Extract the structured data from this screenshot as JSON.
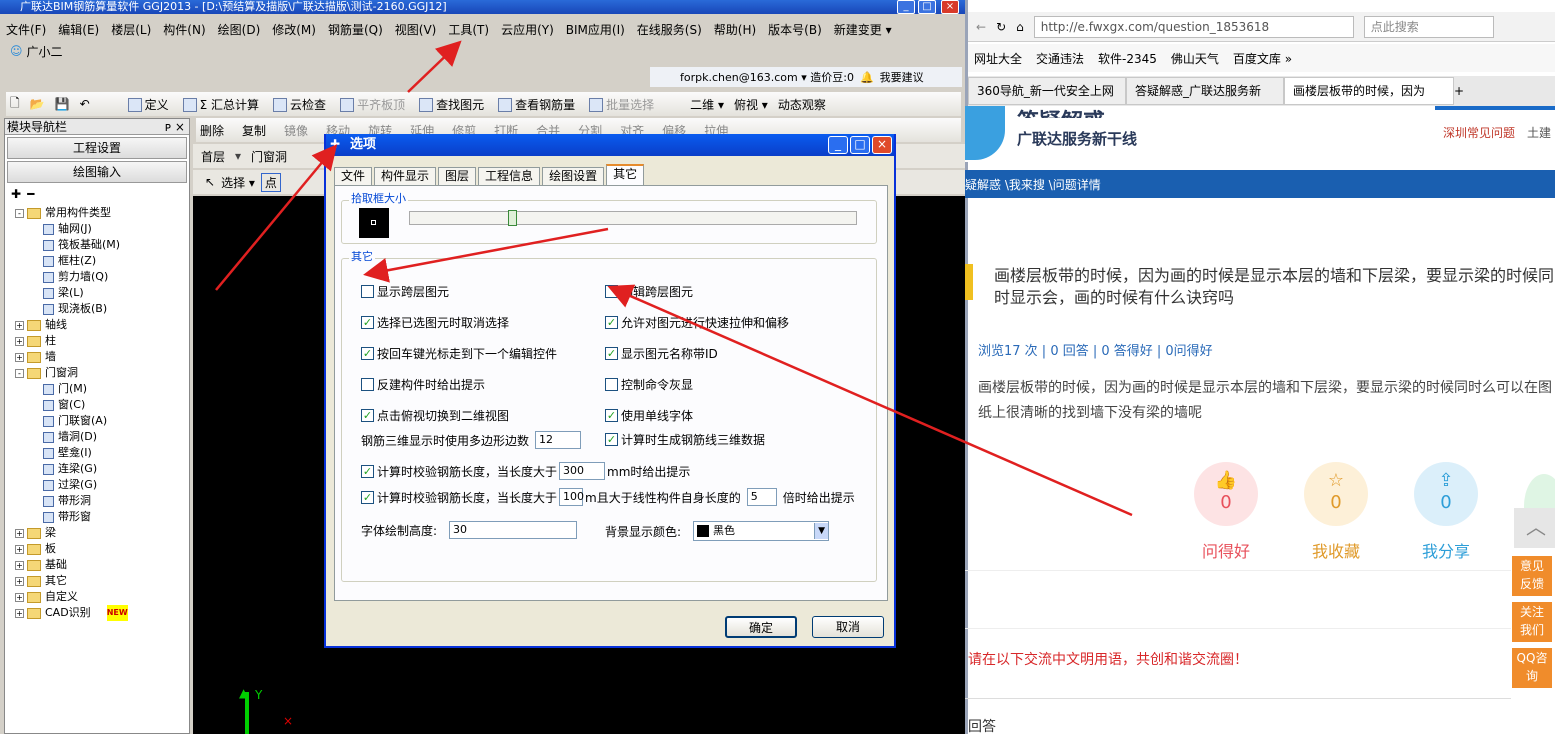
{
  "app": {
    "title": "广联达BIM钢筋算量软件 GGJ2013 - [D:\\预结算及描版\\广联达描版\\测试-2160.GGJ12]",
    "menu": [
      "文件(F)",
      "编辑(E)",
      "楼层(L)",
      "构件(N)",
      "绘图(D)",
      "修改(M)",
      "钢筋量(Q)",
      "视图(V)",
      "工具(T)",
      "云应用(Y)",
      "BIM应用(I)",
      "在线服务(S)",
      "帮助(H)",
      "版本号(B)",
      "新建变更 ▾"
    ],
    "user": "广小二",
    "account": "forpk.chen@163.com ▾ 造价豆:0",
    "suggest": "我要建议",
    "toolbar1": [
      "定义",
      "Σ 汇总计算",
      "云检查",
      "平齐板顶",
      "查找图元",
      "查看钢筋量",
      "批量选择"
    ],
    "view2d": "二维 ▾",
    "view3d": "俯视 ▾",
    "dynamic": "动态观察",
    "toolbar2": [
      "删除",
      "复制",
      "镜像",
      "移动",
      "旋转",
      "延伸",
      "修剪",
      "打断",
      "合并",
      "分割",
      "对齐",
      "偏移",
      "拉伸"
    ],
    "floor": "首层",
    "floor_type": "门窗洞",
    "select": "选择 ▾",
    "point": "点"
  },
  "nav": {
    "header": "模块导航栏",
    "pin": "ᴘ ×",
    "btn1": "工程设置",
    "btn2": "绘图输入",
    "tree": [
      {
        "label": "常用构件类型",
        "type": "folder",
        "exp": "-",
        "level": 0
      },
      {
        "label": "轴网(J)",
        "type": "item",
        "level": 2
      },
      {
        "label": "筏板基础(M)",
        "type": "item",
        "level": 2
      },
      {
        "label": "框柱(Z)",
        "type": "item",
        "level": 2
      },
      {
        "label": "剪力墙(Q)",
        "type": "item",
        "level": 2
      },
      {
        "label": "梁(L)",
        "type": "item",
        "level": 2
      },
      {
        "label": "现浇板(B)",
        "type": "item",
        "level": 2
      },
      {
        "label": "轴线",
        "type": "folder",
        "exp": "+",
        "level": 0
      },
      {
        "label": "柱",
        "type": "folder",
        "exp": "+",
        "level": 0
      },
      {
        "label": "墙",
        "type": "folder",
        "exp": "+",
        "level": 0
      },
      {
        "label": "门窗洞",
        "type": "folder",
        "exp": "-",
        "level": 0
      },
      {
        "label": "门(M)",
        "type": "item",
        "level": 2
      },
      {
        "label": "窗(C)",
        "type": "item",
        "level": 2
      },
      {
        "label": "门联窗(A)",
        "type": "item",
        "level": 2
      },
      {
        "label": "墙洞(D)",
        "type": "item",
        "level": 2
      },
      {
        "label": "壁龛(I)",
        "type": "item",
        "level": 2
      },
      {
        "label": "连梁(G)",
        "type": "item",
        "level": 2
      },
      {
        "label": "过梁(G)",
        "type": "item",
        "level": 2
      },
      {
        "label": "带形洞",
        "type": "item",
        "level": 2
      },
      {
        "label": "带形窗",
        "type": "item",
        "level": 2
      },
      {
        "label": "梁",
        "type": "folder",
        "exp": "+",
        "level": 0
      },
      {
        "label": "板",
        "type": "folder",
        "exp": "+",
        "level": 0
      },
      {
        "label": "基础",
        "type": "folder",
        "exp": "+",
        "level": 0
      },
      {
        "label": "其它",
        "type": "folder",
        "exp": "+",
        "level": 0
      },
      {
        "label": "自定义",
        "type": "folder",
        "exp": "+",
        "level": 0
      },
      {
        "label": "CAD识别",
        "type": "folder",
        "exp": "+",
        "level": 0
      }
    ],
    "new_badge": "NEW"
  },
  "canvas": {
    "y_axis": "Y"
  },
  "dialog": {
    "title": "选项",
    "tabs": [
      "文件",
      "构件显示",
      "图层",
      "工程信息",
      "绘图设置",
      "其它"
    ],
    "active_tab": "其它",
    "pick_group": "拾取框大小",
    "pick_level": 0.22,
    "other_group": "其它",
    "options_left": [
      {
        "label": "显示跨层图元",
        "checked": false
      },
      {
        "label": "选择已选图元时取消选择",
        "checked": true
      },
      {
        "label": "按回车键光标走到下一个编辑控件",
        "checked": true
      },
      {
        "label": "反建构件时给出提示",
        "checked": false
      },
      {
        "label": "点击俯视切换到二维视图",
        "checked": true
      }
    ],
    "options_right": [
      {
        "label": "编辑跨层图元",
        "checked": false
      },
      {
        "label": "允许对图元进行快速拉伸和偏移",
        "checked": true
      },
      {
        "label": "显示图元名称带ID",
        "checked": true
      },
      {
        "label": "控制命令灰显",
        "checked": false
      },
      {
        "label": "使用单线字体",
        "checked": true
      }
    ],
    "poly_label": "钢筋三维显示时使用多边形边数",
    "poly_value": "12",
    "gen3d": "计算时生成钢筋线三维数据",
    "check1_a": "计算时校验钢筋长度，当长度大于",
    "check1_val": "300",
    "check1_b": "mm时给出提示",
    "check2_a": "计算时校验钢筋长度，当长度大于",
    "check2_val": "100",
    "check2_b": "m且大于线性构件自身长度的",
    "check2_val2": "5",
    "check2_c": "倍时给出提示",
    "font_label": "字体绘制高度:",
    "font_value": "30",
    "bg_label": "背景显示颜色:",
    "bg_value": "黑色",
    "ok": "确定",
    "cancel": "取消"
  },
  "browser": {
    "url": "http://e.fwxgx.com/question_1853618",
    "search_placeholder": "点此搜索",
    "bookmarks": [
      "网址大全",
      "交通违法",
      "软件-2345",
      "佛山天气",
      "百度文库 »"
    ],
    "tabs": [
      "360导航_新一代安全上网",
      "答疑解惑_广联达服务新",
      "画楼层板带的时候，因为"
    ],
    "logo_big": "答疑解惑",
    "logo_sub": "广联达服务新干线",
    "top_links": [
      "深圳常见问题",
      "土建"
    ],
    "breadcrumb": "疑解惑 \\我来搜 \\问题详情",
    "question_title": "画楼层板带的时候，因为画的时候是显示本层的墙和下层梁，要显示梁的时候同时显示会，画的时候有什么诀窍吗",
    "stats": "浏览17 次 | 0 回答 | 0 答得好 | 0问得好",
    "question_body": "画楼层板带的时候，因为画的时候是显示本层的墙和下层梁，要显示梁的时候同时么可以在图纸上很清晰的找到墙下没有梁的墙呢",
    "actions": [
      {
        "label": "问得好",
        "count": "0",
        "color": "#e8505b",
        "bg": "#fde3e4"
      },
      {
        "label": "我收藏",
        "count": "0",
        "color": "#e09a2a",
        "bg": "#fdf0d8"
      },
      {
        "label": "我分享",
        "count": "0",
        "color": "#2d9ed8",
        "bg": "#dbeffa"
      }
    ],
    "side": [
      "意见反馈",
      "关注我们",
      "QQ咨询"
    ],
    "notice": "请在以下交流中文明用语，共创和谐交流圈！",
    "answer_head": "回答"
  }
}
